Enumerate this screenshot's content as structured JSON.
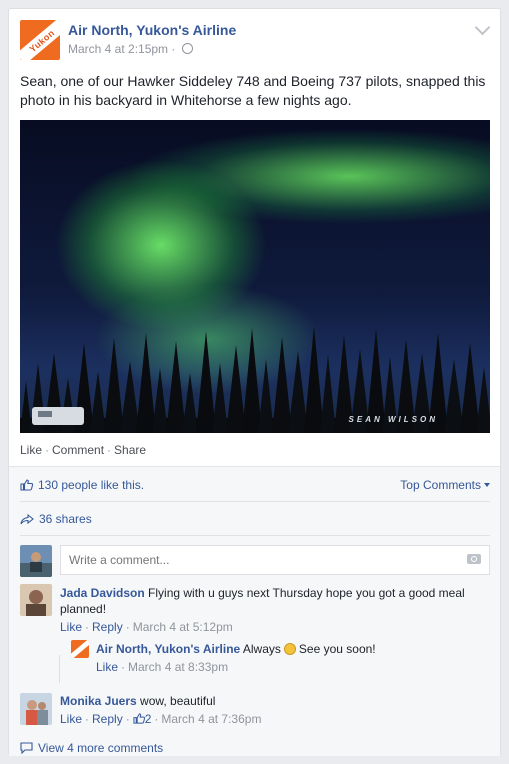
{
  "post": {
    "page_name": "Air North, Yukon's Airline",
    "timestamp": "March 4 at 2:15pm",
    "logo_text": "Yukon",
    "text": "Sean, one of our Hawker Siddeley 748 and Boeing 737 pilots, snapped this photo in his backyard in Whitehorse a few nights ago.",
    "photo_watermark": "SEAN WILSON"
  },
  "actions": {
    "like": "Like",
    "comment": "Comment",
    "share": "Share",
    "sep": "·"
  },
  "footer": {
    "likes_text": "130 people like this.",
    "sort_label": "Top Comments",
    "shares_text": "36 shares",
    "comment_placeholder": "Write a comment...",
    "view_more": "View 4 more comments"
  },
  "comments": [
    {
      "author": "Jada Davidson",
      "text": "Flying with u guys next Thursday hope you got a good meal planned!",
      "like": "Like",
      "reply": "Reply",
      "time": "March 4 at 5:12pm"
    },
    {
      "author": "Air North, Yukon's Airline",
      "text_before": "Always",
      "text_after": "See you soon!",
      "like": "Like",
      "time": "March 4 at 8:33pm"
    },
    {
      "author": "Monika Juers",
      "text": "wow, beautiful",
      "like": "Like",
      "reply": "Reply",
      "likes": "2",
      "time": "March 4 at 7:36pm"
    }
  ],
  "icons": {
    "thumb": "thumbs-up-icon",
    "share": "share-arrow-icon",
    "camera": "camera-icon",
    "comment": "comment-bubble-icon",
    "globe": "globe-icon",
    "chevron": "chevron-down-icon"
  },
  "colors": {
    "link": "#365899",
    "brand_orange": "#ef6b1f",
    "aurora_green": "#6cf064"
  }
}
